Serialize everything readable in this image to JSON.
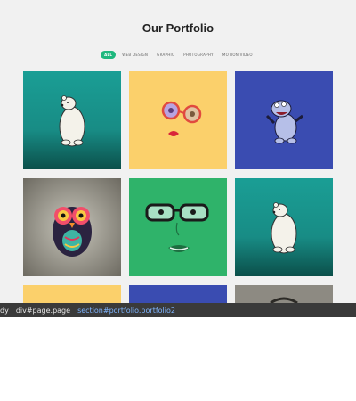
{
  "portfolio": {
    "title": "Our Portfolio",
    "filters": [
      "ALL",
      "WEB DESIGN",
      "GRAPHIC",
      "PHOTOGRAPHY",
      "MOTION VIDEO"
    ],
    "active_filter": "ALL",
    "accent_color": "#1fb87e"
  },
  "gallery": {
    "items": [
      {
        "subject": "polar-bear",
        "background": "teal"
      },
      {
        "subject": "face-with-glasses",
        "background": "yellow"
      },
      {
        "subject": "blue-hippo",
        "background": "blue"
      },
      {
        "subject": "owl",
        "background": "gray"
      },
      {
        "subject": "green-face-with-glasses",
        "background": "green"
      },
      {
        "subject": "polar-bear",
        "background": "teal"
      },
      {
        "subject": "partial-tile",
        "background": "yellow"
      },
      {
        "subject": "partial-tile",
        "background": "blue"
      },
      {
        "subject": "partial-tile",
        "background": "gray"
      }
    ]
  },
  "devtools": {
    "breadcrumbs": [
      "dy",
      "div#page.page",
      "section#portfolio.portfolio2"
    ]
  }
}
